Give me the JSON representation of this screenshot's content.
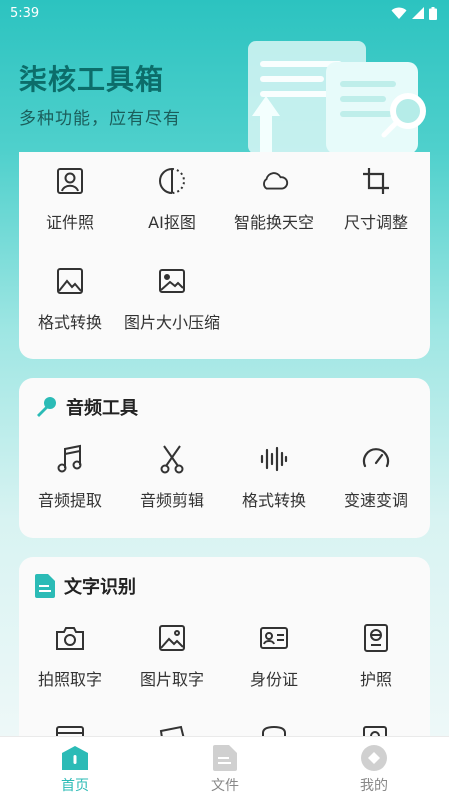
{
  "status_bar": {
    "time": "5:39"
  },
  "hero": {
    "title": "柒核工具箱",
    "subtitle": "多种功能，应有尽有"
  },
  "image_tools": [
    {
      "label": "证件照",
      "icon": "id-photo-icon"
    },
    {
      "label": "AI抠图",
      "icon": "ai-cutout-icon"
    },
    {
      "label": "智能换天空",
      "icon": "cloud-icon"
    },
    {
      "label": "尺寸调整",
      "icon": "crop-icon"
    },
    {
      "label": "格式转换",
      "icon": "image-format-icon"
    },
    {
      "label": "图片大小压缩",
      "icon": "image-compress-icon"
    }
  ],
  "audio_section": {
    "title": "音频工具",
    "items": [
      {
        "label": "音频提取",
        "icon": "music-note-icon"
      },
      {
        "label": "音频剪辑",
        "icon": "scissors-icon"
      },
      {
        "label": "格式转换",
        "icon": "audio-wave-icon"
      },
      {
        "label": "变速变调",
        "icon": "speedometer-icon"
      }
    ]
  },
  "ocr_section": {
    "title": "文字识别",
    "items": [
      {
        "label": "拍照取字",
        "icon": "camera-icon"
      },
      {
        "label": "图片取字",
        "icon": "picture-icon"
      },
      {
        "label": "身份证",
        "icon": "id-card-icon"
      },
      {
        "label": "护照",
        "icon": "passport-icon"
      }
    ]
  },
  "bottom_nav": [
    {
      "label": "首页",
      "active": true
    },
    {
      "label": "文件",
      "active": false
    },
    {
      "label": "我的",
      "active": false
    }
  ],
  "colors": {
    "accent": "#2bbbb6",
    "hero_title": "#0c6d6a",
    "icon": "#333333"
  }
}
